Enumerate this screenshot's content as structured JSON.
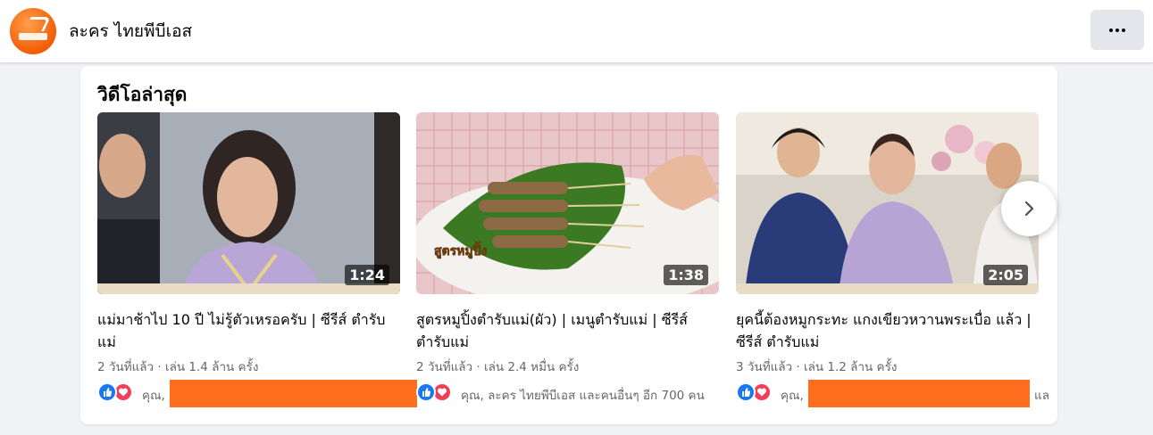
{
  "header": {
    "page_name": "ละคร ไทยพีบีเอส",
    "more_icon": "more-dots-icon"
  },
  "section": {
    "title": "วิดีโอล่าสุด"
  },
  "videos": [
    {
      "title": "แม่มาช้าไป 10 ปี ไม่รู้ตัวเหรอครับ | ซีรีส์ ตำรับแม่",
      "duration": "1:24",
      "meta": "2 วันที่แล้ว · เล่น 1.4 ล้าน ครั้ง",
      "reactions_text": "คุณ,"
    },
    {
      "title": "สูตรหมูปิ้งตำรับแม่(ผัว) | เมนูตำรับแม่ | ซีรีส์ ตำรับแม่",
      "duration": "1:38",
      "meta": "2 วันที่แล้ว · เล่น 2.4 หมื่น ครั้ง",
      "reactions_text": "คุณ, ละคร ไทยพีบีเอส และคนอื่นๆ อีก 700 คน",
      "thumb_overlay": "สูตรหมูปิ้ง"
    },
    {
      "title": "ยุคนี้ต้องหมูกระทะ แกงเขียวหวานพระเบื่อ แล้ว | ซีรีส์ ตำรับแม่",
      "duration": "2:05",
      "meta": "3 วันที่แล้ว · เล่น 1.2 ล้าน ครั้ง",
      "reactions_text": "คุณ,",
      "reactions_tail": "แล"
    }
  ],
  "icons": {
    "like": "like-icon",
    "love": "love-icon",
    "next": "chevron-right-icon"
  },
  "colors": {
    "redaction": "#ff6d1f",
    "like": "#1877f2",
    "love": "#f33e58",
    "brand_orange": "#f25c05"
  }
}
